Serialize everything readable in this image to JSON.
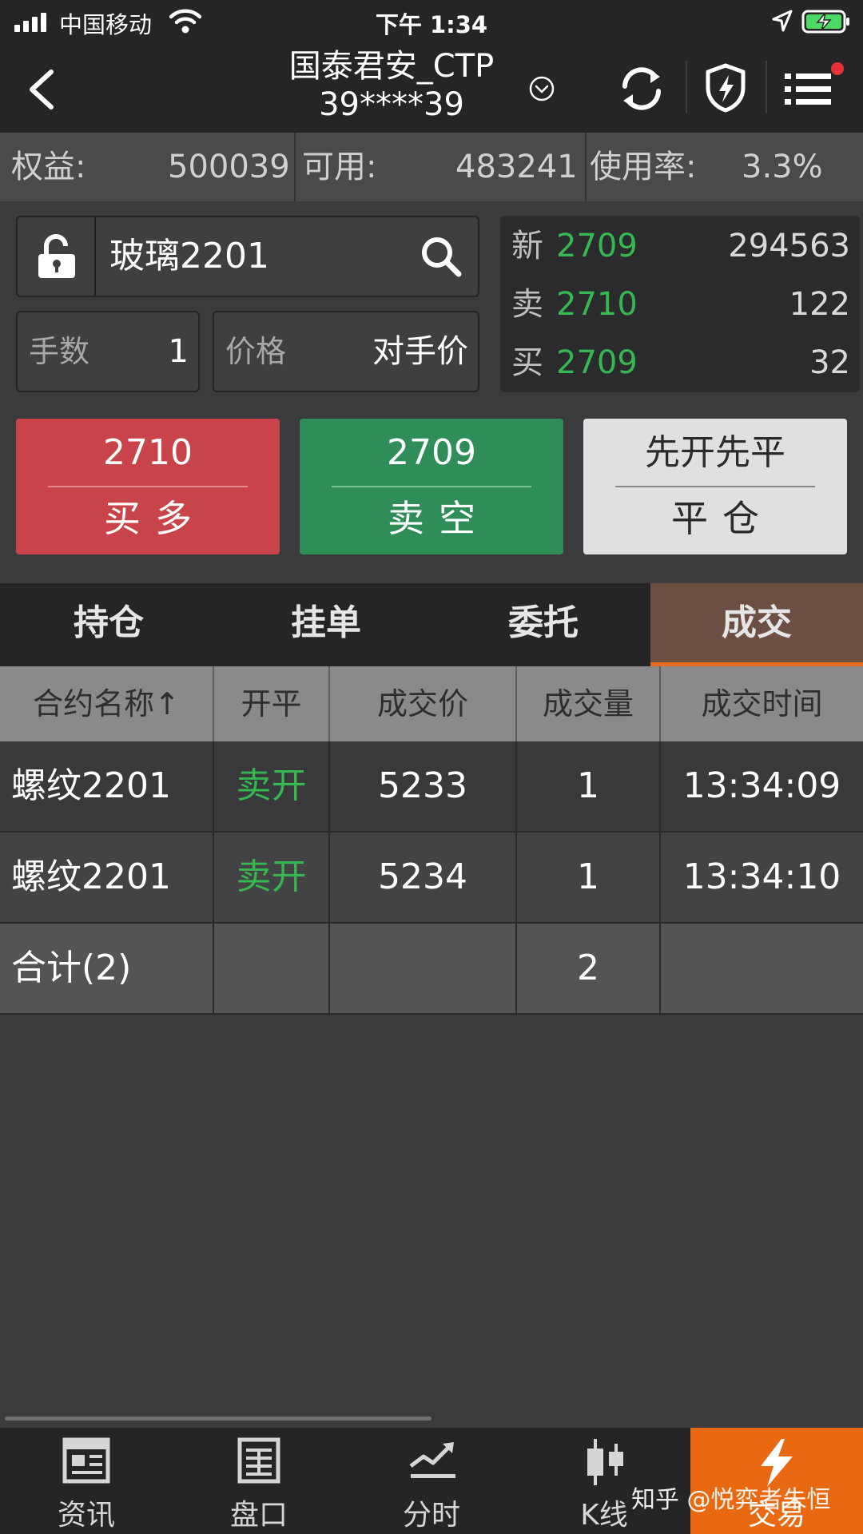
{
  "status_bar": {
    "carrier": "中国移动",
    "time": "下午 1:34"
  },
  "header": {
    "title": "国泰君安_CTP",
    "account": "39****39"
  },
  "account": {
    "equity_label": "权益:",
    "equity_value": "500039",
    "available_label": "可用:",
    "available_value": "483241",
    "usage_label": "使用率:",
    "usage_value": "3.3%"
  },
  "order": {
    "symbol": "玻璃2201",
    "qty_label": "手数",
    "qty_value": "1",
    "price_label": "价格",
    "price_value": "对手价"
  },
  "quote": {
    "rows": [
      {
        "label": "新",
        "price": "2709",
        "volume": "294563"
      },
      {
        "label": "卖",
        "price": "2710",
        "volume": "122"
      },
      {
        "label": "买",
        "price": "2709",
        "volume": "32"
      }
    ]
  },
  "buttons": {
    "buy": {
      "price": "2710",
      "label": "买多"
    },
    "sell": {
      "price": "2709",
      "label": "卖空"
    },
    "close": {
      "mode": "先开先平",
      "label": "平仓"
    }
  },
  "tabs": [
    {
      "label": "持仓",
      "active": false
    },
    {
      "label": "挂单",
      "active": false
    },
    {
      "label": "委托",
      "active": false
    },
    {
      "label": "成交",
      "active": true
    }
  ],
  "table": {
    "headers": [
      "合约名称↑",
      "开平",
      "成交价",
      "成交量",
      "成交时间"
    ],
    "rows": [
      {
        "name": "螺纹2201",
        "open_close": "卖开",
        "price": "5233",
        "volume": "1",
        "time": "13:34:09"
      },
      {
        "name": "螺纹2201",
        "open_close": "卖开",
        "price": "5234",
        "volume": "1",
        "time": "13:34:10"
      }
    ],
    "total": {
      "label": "合计(2)",
      "volume": "2"
    }
  },
  "bottom_nav": [
    {
      "label": "资讯",
      "icon": "news-icon",
      "active": false
    },
    {
      "label": "盘口",
      "icon": "order-book-icon",
      "active": false
    },
    {
      "label": "分时",
      "icon": "intraday-chart-icon",
      "active": false
    },
    {
      "label": "K线",
      "icon": "candlestick-icon",
      "active": false
    },
    {
      "label": "交易",
      "icon": "lightning-icon",
      "active": true
    }
  ],
  "watermark": "知乎 @悦弈者朱恒",
  "colors": {
    "up_red": "#c8444a",
    "down_green": "#2f8e58",
    "price_green": "#34b84f",
    "accent_orange": "#e8690f"
  }
}
